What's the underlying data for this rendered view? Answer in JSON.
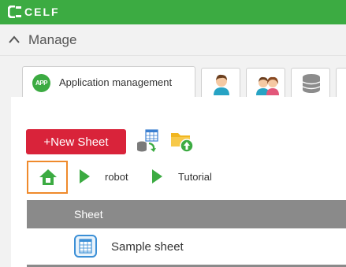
{
  "header": {
    "logo_text": "CELF",
    "logo_icon": "celf-logo-icon",
    "color": "#3cab42"
  },
  "manage": {
    "label": "Manage",
    "icon": "chevron-up-icon"
  },
  "tabs": [
    {
      "label": "Application management",
      "badge": "APP",
      "active": true
    },
    {
      "icon": "user-icon"
    },
    {
      "icon": "users-group-icon"
    },
    {
      "icon": "database-icon"
    }
  ],
  "toolbar": {
    "new_sheet_label": "+New Sheet",
    "new_sheet_color": "#d9233a",
    "import_icon": "sheet-import-icon",
    "upload_icon": "folder-upload-icon"
  },
  "breadcrumb": {
    "home_icon": "home-icon",
    "items": [
      "robot",
      "Tutorial"
    ]
  },
  "table": {
    "columns": [
      "Sheet"
    ],
    "rows": [
      {
        "icon": "sheet-icon",
        "name": "Sample sheet"
      }
    ]
  }
}
